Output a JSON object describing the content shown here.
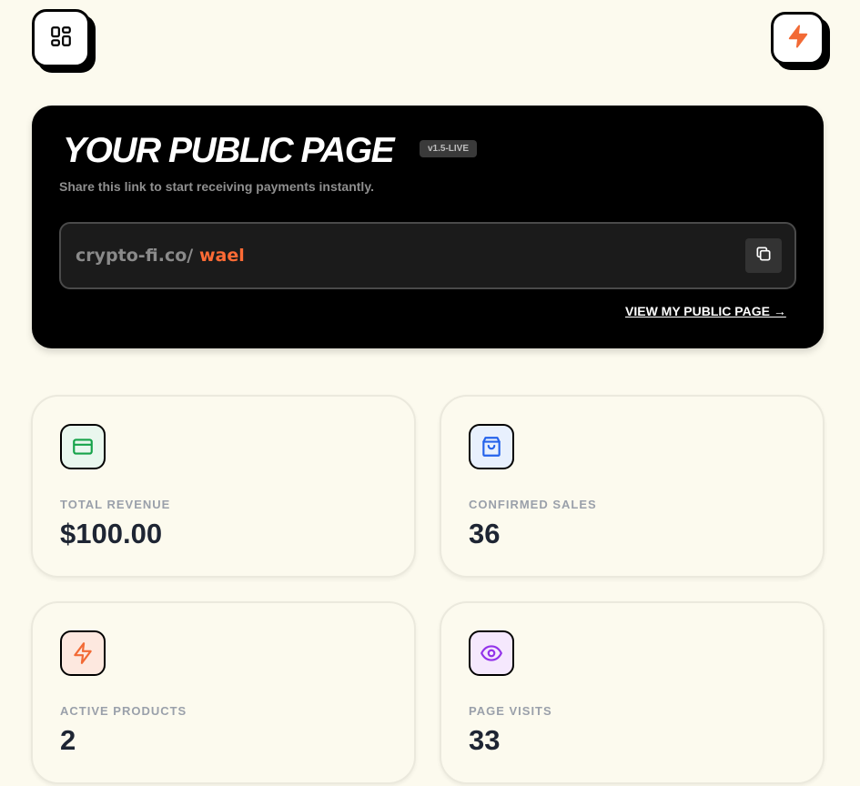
{
  "header": {
    "menu_icon": "grid-icon",
    "flash_icon": "lightning-icon"
  },
  "hero": {
    "title": "YOUR PUBLIC PAGE",
    "version": "v1.5-LIVE",
    "subtitle": "Share this link to start receiving payments instantly.",
    "link_prefix": "crypto-fi.co/",
    "link_slug": "wael",
    "copy_icon": "copy-icon",
    "view_link": "VIEW MY PUBLIC PAGE →"
  },
  "stats": [
    {
      "label": "TOTAL REVENUE",
      "value": "$100.00",
      "icon": "credit-card-icon",
      "color": "#16a34a",
      "bg": "#e9f7ee"
    },
    {
      "label": "CONFIRMED SALES",
      "value": "36",
      "icon": "shopping-bag-icon",
      "color": "#2563eb",
      "bg": "#e8f0fd"
    },
    {
      "label": "ACTIVE PRODUCTS",
      "value": "2",
      "icon": "lightning-icon",
      "color": "#f26a35",
      "bg": "#fde8df"
    },
    {
      "label": "PAGE VISITS",
      "value": "33",
      "icon": "eye-icon",
      "color": "#9333ea",
      "bg": "#f5e8fd"
    }
  ],
  "colors": {
    "accent": "#ff6b35",
    "background": "#fcfaee"
  }
}
